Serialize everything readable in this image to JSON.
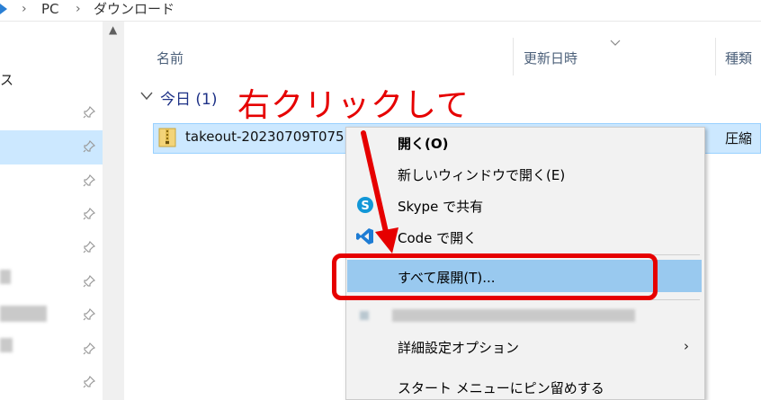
{
  "breadcrumb": {
    "items": [
      "PC",
      "ダウンロード"
    ]
  },
  "navigation": {
    "partial_label": "ス",
    "pinned_count": 9
  },
  "columns": {
    "name": "名前",
    "modified": "更新日時",
    "type": "種類"
  },
  "group": {
    "label": "今日 (1)"
  },
  "file": {
    "name": "takeout-20230709T075",
    "type": "圧縮"
  },
  "context_menu": {
    "open": "開く(O)",
    "open_new_window": "新しいウィンドウで開く(E)",
    "skype_share": "Skype で共有",
    "code_open": "Code で開く",
    "extract_all": "すべて展開(T)...",
    "advanced_options": "詳細設定オプション",
    "pin_start": "スタート メニューにピン留めする",
    "submenu_arrow": "›"
  },
  "annotation": {
    "text": "右クリックして",
    "color": "#e60000"
  },
  "colors": {
    "selection": "#cce8ff",
    "highlight": "#99c9ef",
    "accent_red": "#e60000"
  }
}
